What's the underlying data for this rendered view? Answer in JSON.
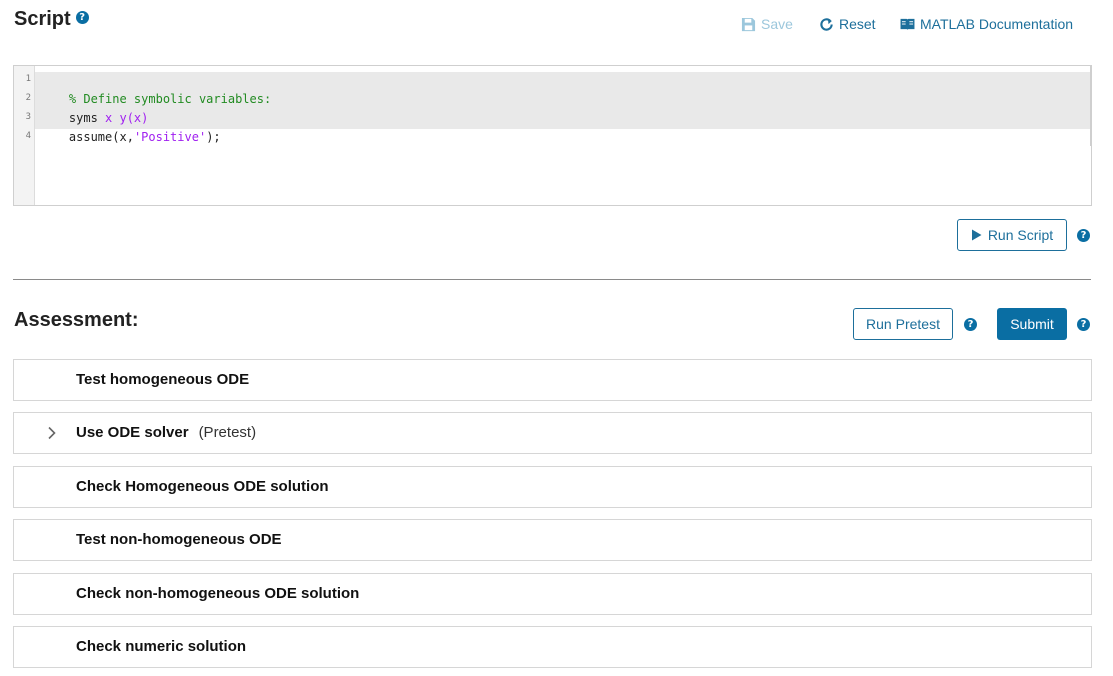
{
  "script": {
    "title": "Script",
    "help": "?",
    "toolbar": {
      "save_label": "Save",
      "reset_label": "Reset",
      "doc_label": "MATLAB Documentation"
    },
    "editor": {
      "line_numbers": [
        "1",
        "2",
        "3",
        "4"
      ],
      "lines": [
        [
          {
            "t": "% Define symbolic variables:",
            "c": "comment"
          }
        ],
        [
          {
            "t": "syms ",
            "c": "plain"
          },
          {
            "t": "x y(x)",
            "c": "var"
          }
        ],
        [
          {
            "t": "assume(x,",
            "c": "plain"
          },
          {
            "t": "'Positive'",
            "c": "str"
          },
          {
            "t": ");",
            "c": "plain"
          }
        ],
        []
      ]
    },
    "run_label": "Run Script",
    "run_help": "?"
  },
  "assessment": {
    "title": "Assessment:",
    "pretest_label": "Run Pretest",
    "pretest_help": "?",
    "submit_label": "Submit",
    "submit_help": "?",
    "items": [
      {
        "label": "Test homogeneous ODE",
        "note": "",
        "expandable": false
      },
      {
        "label": "Use ODE solver",
        "note": "(Pretest)",
        "expandable": true
      },
      {
        "label": "Check Homogeneous ODE solution",
        "note": "",
        "expandable": false
      },
      {
        "label": "Test non-homogeneous ODE",
        "note": "",
        "expandable": false
      },
      {
        "label": "Check non-homogeneous ODE solution",
        "note": "",
        "expandable": false
      },
      {
        "label": "Check numeric solution",
        "note": "",
        "expandable": false
      }
    ]
  },
  "colors": {
    "accent": "#0a6ea3",
    "link": "#1d6f9b",
    "disabled": "#9cc7dc",
    "comment": "#228b22",
    "string": "#a020f0"
  }
}
